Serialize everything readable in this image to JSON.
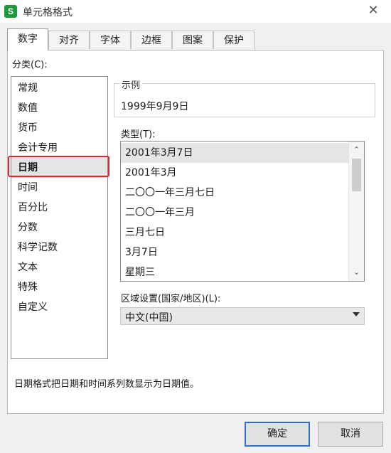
{
  "window": {
    "title": "单元格格式",
    "app_icon_letter": "S",
    "close_glyph": "✕"
  },
  "tabs": [
    {
      "label": "数字",
      "active": true
    },
    {
      "label": "对齐"
    },
    {
      "label": "字体"
    },
    {
      "label": "边框"
    },
    {
      "label": "图案"
    },
    {
      "label": "保护"
    }
  ],
  "category": {
    "label": "分类(C):",
    "items": [
      "常规",
      "数值",
      "货币",
      "会计专用",
      "日期",
      "时间",
      "百分比",
      "分数",
      "科学记数",
      "文本",
      "特殊",
      "自定义"
    ],
    "selected": "日期"
  },
  "example": {
    "title": "示例",
    "value": "1999年9月9日"
  },
  "type": {
    "label": "类型(T):",
    "items": [
      "2001年3月7日",
      "2001年3月",
      "二〇〇一年三月七日",
      "二〇〇一年三月",
      "三月七日",
      "3月7日",
      "星期三"
    ],
    "selected": "2001年3月7日",
    "scroll_up": "⌃",
    "scroll_down": "⌄"
  },
  "locale": {
    "label": "区域设置(国家/地区)(L):",
    "value": "中文(中国)"
  },
  "description": "日期格式把日期和时间系列数显示为日期值。",
  "buttons": {
    "ok": "确定",
    "cancel": "取消"
  },
  "colors": {
    "highlight": "#e0252d",
    "primary_border": "#2b6fd6",
    "app_icon": "#1a9a3b"
  }
}
